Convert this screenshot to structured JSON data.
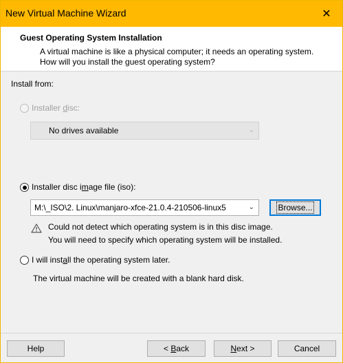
{
  "window": {
    "title": "New Virtual Machine Wizard"
  },
  "header": {
    "title": "Guest Operating System Installation",
    "description": "A virtual machine is like a physical computer; it needs an operating system. How will you install the guest operating system?"
  },
  "install_from_label": "Install from:",
  "options": {
    "disc": {
      "label_pre": "Installer ",
      "label_u": "d",
      "label_post": "isc:",
      "selected": false,
      "enabled": false,
      "dropdown_value": "No drives available"
    },
    "iso": {
      "label_pre": "Installer disc i",
      "label_u": "m",
      "label_post": "age file (iso):",
      "selected": true,
      "path": "M:\\_ISO\\2. Linux\\manjaro-xfce-21.0.4-210506-linux5",
      "browse_label": "Browse..."
    },
    "later": {
      "label_pre": "I will inst",
      "label_u": "a",
      "label_post": "ll the operating system later.",
      "selected": false,
      "description": "The virtual machine will be created with a blank hard disk."
    }
  },
  "warning": {
    "line1": "Could not detect which operating system is in this disc image.",
    "line2": "You will need to specify which operating system will be installed."
  },
  "footer": {
    "help": "Help",
    "back_pre": "< ",
    "back_u": "B",
    "back_post": "ack",
    "next_u": "N",
    "next_post": "ext >",
    "cancel": "Cancel"
  }
}
